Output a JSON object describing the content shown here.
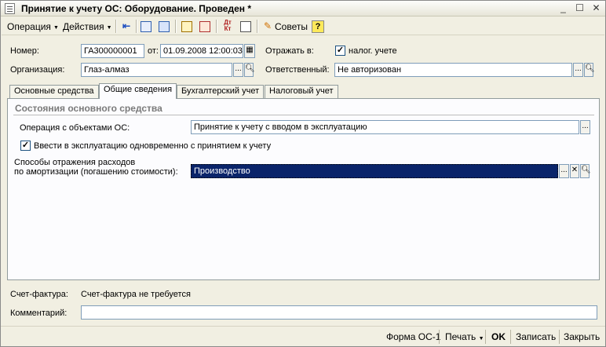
{
  "window": {
    "title": "Принятие к учету ОС: Оборудование. Проведен *"
  },
  "toolbar": {
    "operation_menu": "Операция",
    "actions_menu": "Действия",
    "advice_label": "Советы",
    "help_label": "?"
  },
  "header": {
    "number_label": "Номер:",
    "number_value": "ГА300000001",
    "from_label": "от:",
    "date_value": "01.09.2008 12:00:03",
    "reflect_label": "Отражать в:",
    "tax_accounting_label": "налог. учете",
    "tax_accounting_checked": true,
    "organization_label": "Организация:",
    "organization_value": "Глаз-алмаз",
    "responsible_label": "Ответственный:",
    "responsible_value": "Не авторизован"
  },
  "tabs": [
    {
      "label": "Основные средства",
      "active": false
    },
    {
      "label": "Общие сведения",
      "active": true
    },
    {
      "label": "Бухгалтерский учет",
      "active": false
    },
    {
      "label": "Налоговый учет",
      "active": false
    }
  ],
  "general": {
    "group_title": "Состояния основного средства",
    "operation_label": "Операция с объектами ОС:",
    "operation_value": "Принятие к учету с вводом в эксплуатацию",
    "commission_checkbox_label": "Ввести в эксплуатацию одновременно с принятием к учету",
    "commission_checked": true,
    "depreciation_label_line1": "Способы отражения расходов",
    "depreciation_label_line2": "по амортизации (погашению стоимости):",
    "depreciation_value": "Производство"
  },
  "footer": {
    "invoice_label": "Счет-фактура:",
    "invoice_value": "Счет-фактура не требуется",
    "comment_label": "Комментарий:",
    "comment_value": ""
  },
  "bottom_buttons": {
    "form_os1": "Форма ОС-1",
    "print": "Печать",
    "ok": "OK",
    "save": "Записать",
    "close": "Закрыть"
  }
}
